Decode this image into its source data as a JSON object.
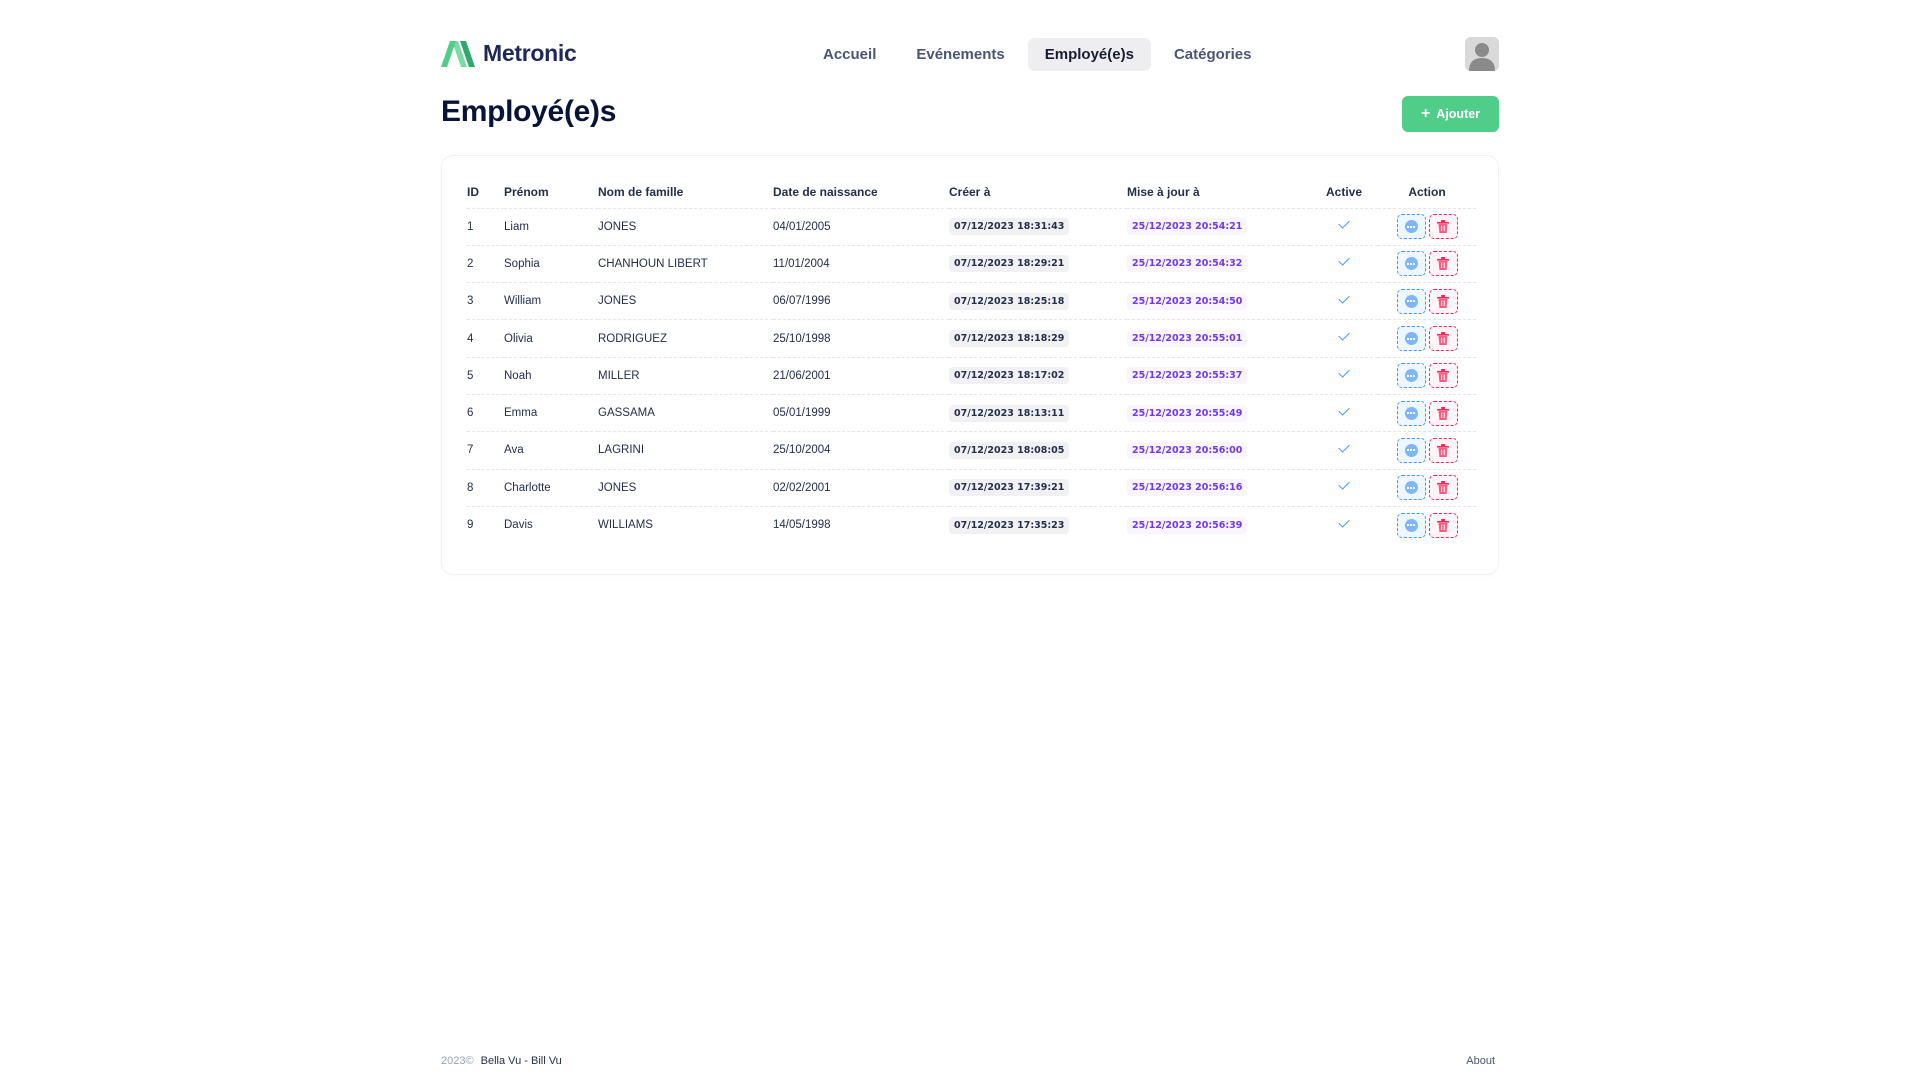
{
  "brand": {
    "name": "Metronic"
  },
  "nav": [
    {
      "label": "Accueil",
      "active": false
    },
    {
      "label": "Evénements",
      "active": false
    },
    {
      "label": "Employé(e)s",
      "active": true
    },
    {
      "label": "Catégories",
      "active": false
    }
  ],
  "page": {
    "title": "Employé(e)s",
    "add_label": "Ajouter"
  },
  "table": {
    "headers": {
      "id": "ID",
      "first": "Prénom",
      "last": "Nom de famille",
      "dob": "Date de naissance",
      "created": "Créer à",
      "updated": "Mise à jour à",
      "active": "Active",
      "action": "Action"
    },
    "rows": [
      {
        "id": "1",
        "first": "Liam",
        "last": "JONES",
        "dob": "04/01/2005",
        "created": "07/12/2023 18:31:43",
        "updated": "25/12/2023 20:54:21",
        "active": true
      },
      {
        "id": "2",
        "first": "Sophia",
        "last": "CHANHOUN LIBERT",
        "dob": "11/01/2004",
        "created": "07/12/2023 18:29:21",
        "updated": "25/12/2023 20:54:32",
        "active": true
      },
      {
        "id": "3",
        "first": "William",
        "last": "JONES",
        "dob": "06/07/1996",
        "created": "07/12/2023 18:25:18",
        "updated": "25/12/2023 20:54:50",
        "active": true
      },
      {
        "id": "4",
        "first": "Olivia",
        "last": "RODRIGUEZ",
        "dob": "25/10/1998",
        "created": "07/12/2023 18:18:29",
        "updated": "25/12/2023 20:55:01",
        "active": true
      },
      {
        "id": "5",
        "first": "Noah",
        "last": "MILLER",
        "dob": "21/06/2001",
        "created": "07/12/2023 18:17:02",
        "updated": "25/12/2023 20:55:37",
        "active": true
      },
      {
        "id": "6",
        "first": "Emma",
        "last": "GASSAMA",
        "dob": "05/01/1999",
        "created": "07/12/2023 18:13:11",
        "updated": "25/12/2023 20:55:49",
        "active": true
      },
      {
        "id": "7",
        "first": "Ava",
        "last": "LAGRINI",
        "dob": "25/10/2004",
        "created": "07/12/2023 18:08:05",
        "updated": "25/12/2023 20:56:00",
        "active": true
      },
      {
        "id": "8",
        "first": "Charlotte",
        "last": "JONES",
        "dob": "02/02/2001",
        "created": "07/12/2023 17:39:21",
        "updated": "25/12/2023 20:56:16",
        "active": true
      },
      {
        "id": "9",
        "first": "Davis",
        "last": "WILLIAMS",
        "dob": "14/05/1998",
        "created": "07/12/2023 17:35:23",
        "updated": "25/12/2023 20:56:39",
        "active": true
      }
    ]
  },
  "footer": {
    "year": "2023©",
    "author": "Bella Vu - Bill Vu",
    "about": "About"
  },
  "colors": {
    "accent_green": "#50cd89",
    "primary_blue": "#3e97ff",
    "danger": "#f8285a",
    "purple": "#7239ea"
  },
  "icons": {
    "logo": "metronic-logo-icon",
    "avatar": "user-avatar-icon",
    "add": "plus-icon",
    "active": "check-icon",
    "view": "more-dots-icon",
    "delete": "trash-icon"
  }
}
